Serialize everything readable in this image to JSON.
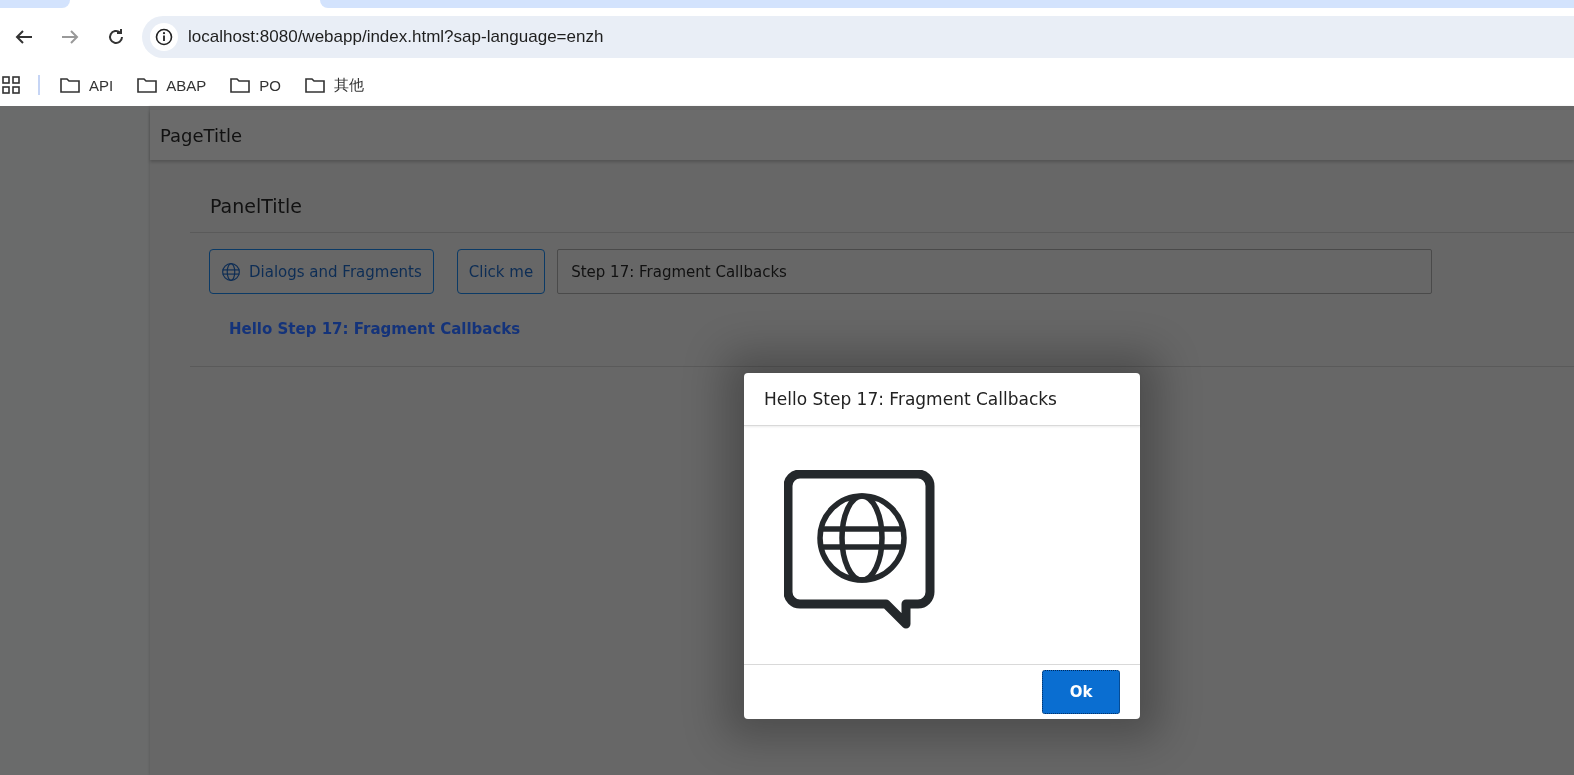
{
  "browser": {
    "url": "localhost:8080/webapp/index.html?sap-language=enzh",
    "bookmarks": [
      {
        "label": "API"
      },
      {
        "label": "ABAP"
      },
      {
        "label": "PO"
      },
      {
        "label": "其他"
      }
    ]
  },
  "page": {
    "title": "PageTitle"
  },
  "panel": {
    "title": "PanelTitle",
    "icon_button": "Dialogs and Fragments",
    "button": "Click me",
    "input_value": "Step 17: Fragment Callbacks",
    "text": "Hello Step 17: Fragment Callbacks"
  },
  "dialog": {
    "title": "Hello Step 17: Fragment Callbacks",
    "buttons": [
      "Ok"
    ]
  }
}
